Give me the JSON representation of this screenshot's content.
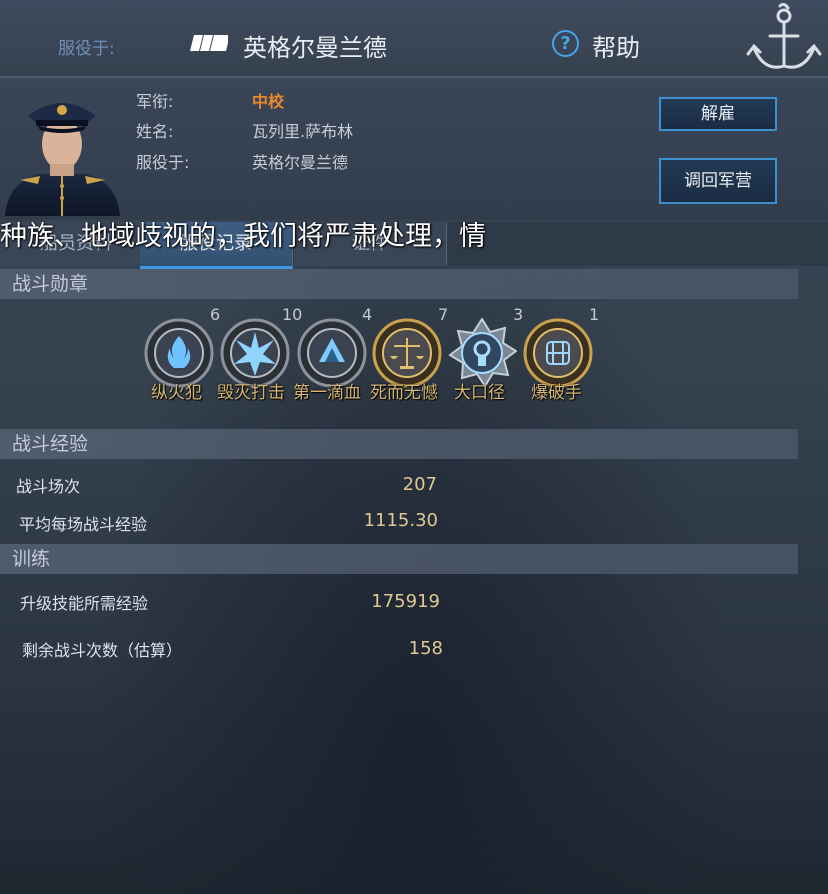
{
  "header": {
    "serve_label": "服役于:",
    "country": "英格尔曼兰德",
    "help_label": "帮助"
  },
  "profile": {
    "rank_label": "军衔:",
    "rank_value": "中校",
    "name_label": "姓名:",
    "name_value": "瓦列里.萨布林",
    "serve_label": "服役于:",
    "serve_value": "英格尔曼兰德",
    "dismiss_button": "解雇",
    "recall_button": "调回军营"
  },
  "tabs": [
    {
      "label": "船员资料"
    },
    {
      "label": "服役记录"
    },
    {
      "label": "证件"
    }
  ],
  "overlay_caption": "种族、地域歧视的，我们将严肃处理，情",
  "medals_section": {
    "title": "战斗勋章",
    "medals": [
      {
        "name": "纵火犯",
        "count": "6",
        "icon": "flame-medal-icon"
      },
      {
        "name": "毁灭打击",
        "count": "10",
        "icon": "explosion-medal-icon"
      },
      {
        "name": "第一滴血",
        "count": "4",
        "icon": "first-blood-medal-icon"
      },
      {
        "name": "死而无憾",
        "count": "7",
        "icon": "scales-medal-icon"
      },
      {
        "name": "大口径",
        "count": "3",
        "icon": "big-gun-medal-icon"
      },
      {
        "name": "爆破手",
        "count": "1",
        "icon": "demolition-medal-icon"
      }
    ]
  },
  "experience_section": {
    "title": "战斗经验",
    "battles_label": "战斗场次",
    "battles_value": "207",
    "avg_exp_label": "平均每场战斗经验",
    "avg_exp_value": "1115.30"
  },
  "training_section": {
    "title": "训练",
    "skill_exp_label": "升级技能所需经验",
    "skill_exp_value": "175919",
    "remaining_label": "剩余战斗次数（估算）",
    "remaining_value": "158"
  },
  "colors": {
    "accent_blue": "#3d8fd0",
    "rank_orange": "#e8892a",
    "value_gold": "#e0c892"
  }
}
